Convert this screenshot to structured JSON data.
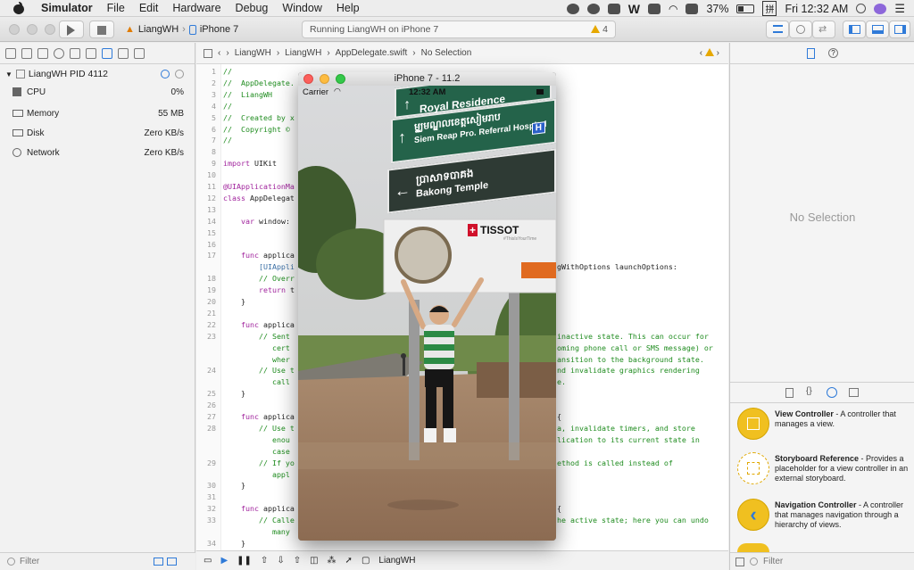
{
  "menubar": {
    "app": "Simulator",
    "items": [
      "File",
      "Edit",
      "Hardware",
      "Debug",
      "Window",
      "Help"
    ],
    "battery": "37%",
    "clock": "Fri 12:32 AM"
  },
  "toolbar": {
    "scheme": "LiangWH",
    "device": "iPhone 7",
    "activity": "Running LiangWH on iPhone 7",
    "warning_count": "4"
  },
  "debug": {
    "process": "LiangWH PID 4112",
    "rows": [
      {
        "label": "CPU",
        "value": "0%"
      },
      {
        "label": "Memory",
        "value": "55 MB"
      },
      {
        "label": "Disk",
        "value": "Zero KB/s"
      },
      {
        "label": "Network",
        "value": "Zero KB/s"
      }
    ],
    "filter_placeholder": "Filter"
  },
  "editor": {
    "breadcrumb": [
      "LiangWH",
      "LiangWH",
      "AppDelegate.swift",
      "No Selection"
    ],
    "footer_target": "LiangWH"
  },
  "simulator": {
    "title": "iPhone 7 - 11.2",
    "carrier": "Carrier",
    "time": "12:32 AM",
    "signs": [
      "Royal Residence",
      "ម្ជ្ឈមណ្ឌលខេត្តសៀមរាប",
      "Siem Reap Pro. Referral Hospital",
      "ប្រាសាទបាគង",
      "Bakong Temple"
    ],
    "ad_brand": "TISSOT",
    "ad_tagline": "#ThisIsYourTime"
  },
  "inspector": {
    "empty": "No Selection",
    "library": [
      {
        "title": "View Controller",
        "desc": " - A controller that manages a view."
      },
      {
        "title": "Storyboard Reference",
        "desc": " - Provides a placeholder for a view controller in an external storyboard."
      },
      {
        "title": "Navigation Controller",
        "desc": " - A controller that manages navigation through a hierarchy of views."
      }
    ],
    "filter_placeholder": "Filter"
  },
  "colors": {
    "accent": "#2f7ad8",
    "sign_green": "#24634a",
    "comment": "#1f8c1f",
    "keyword": "#a1249d"
  }
}
